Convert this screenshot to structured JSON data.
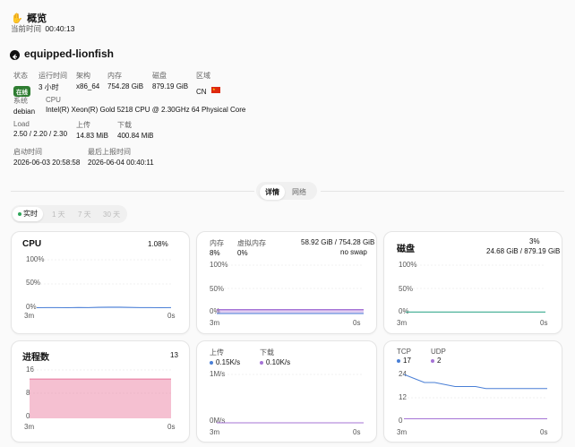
{
  "header": {
    "icon": "waving-hand-icon",
    "title": "概览",
    "time_label": "当前时间",
    "time_value": "00:40:13"
  },
  "server": {
    "name": "equipped-lionfish",
    "back_icon": "back-arrow-icon",
    "fields": {
      "status": {
        "label": "状态",
        "value": "在线"
      },
      "uptime": {
        "label": "运行时间",
        "value": "3 小时"
      },
      "arch": {
        "label": "架构",
        "value": "x86_64"
      },
      "memory": {
        "label": "内存",
        "value": "754.28 GiB"
      },
      "disk": {
        "label": "磁盘",
        "value": "879.19 GiB"
      },
      "region": {
        "label": "区域",
        "value": "CN"
      },
      "system": {
        "label": "系统",
        "value": "debian"
      },
      "cpu": {
        "label": "CPU",
        "value": "Intel(R) Xeon(R) Gold 5218 CPU @ 2.30GHz 64 Physical Core"
      },
      "load": {
        "label": "Load",
        "value": "2.50 / 2.20 / 2.30"
      },
      "upload": {
        "label": "上传",
        "value": "14.83 MiB"
      },
      "download": {
        "label": "下载",
        "value": "400.84 MiB"
      },
      "boot_time": {
        "label": "启动时间",
        "value": "2026-06-03 20:58:58"
      },
      "last_report": {
        "label": "最后上报时间",
        "value": "2026-06-04 00:40:11"
      }
    }
  },
  "tabs": {
    "details": "详情",
    "network": "网络",
    "active": "details"
  },
  "ranges": {
    "realtime": "实时",
    "day1": "1 天",
    "day7": "7 天",
    "day30": "30 天",
    "active": "realtime"
  },
  "cards": {
    "cpu": {
      "title": "CPU",
      "value": "1.08%",
      "y_ticks": [
        "100%",
        "50%",
        "0%"
      ],
      "x_start": "3m",
      "x_end": "0s",
      "chart_data": {
        "type": "area",
        "ylim": [
          0,
          100
        ],
        "values": [
          1.0,
          1.2,
          1.1,
          1.0,
          1.3,
          1.2,
          1.8,
          2.0,
          2.1,
          1.6,
          1.2,
          1.1,
          1.0,
          1.08
        ]
      },
      "color": "#4a7fd6"
    },
    "memory": {
      "mem_label": "内存",
      "mem_value": "8%",
      "swap_label": "虚拟内存",
      "swap_value": "0%",
      "usage": "58.92 GiB / 754.28 GiB",
      "swap_note": "no swap",
      "y_ticks": [
        "100%",
        "50%",
        "0%"
      ],
      "x_start": "3m",
      "x_end": "0s",
      "chart_data": {
        "type": "area",
        "ylim": [
          0,
          100
        ],
        "series": [
          {
            "values": [
              8,
              8,
              8,
              8,
              8,
              8,
              8,
              8
            ]
          },
          {
            "values": [
              0,
              0,
              0,
              0,
              0,
              0,
              0,
              0
            ]
          }
        ]
      },
      "colors": [
        "#a573d6",
        "#4a7fd6"
      ]
    },
    "disk": {
      "title": "磁盘",
      "value": "3%",
      "usage": "24.68 GiB / 879.19 GiB",
      "y_ticks": [
        "100%",
        "50%",
        "0%"
      ],
      "x_start": "3m",
      "x_end": "0s",
      "chart_data": {
        "type": "line",
        "ylim": [
          0,
          100
        ],
        "values": [
          3,
          3,
          3,
          3,
          3,
          3,
          3,
          3
        ]
      },
      "color": "#4fb39a"
    },
    "process": {
      "title": "进程数",
      "value": "13",
      "y_ticks": [
        "16",
        "8",
        "0"
      ],
      "x_start": "3m",
      "x_end": "0s",
      "chart_data": {
        "type": "area",
        "ylim": [
          0,
          16
        ],
        "values": [
          13,
          13,
          13,
          13,
          13,
          13,
          13,
          13
        ]
      },
      "color": "#e8739a"
    },
    "network": {
      "up_label": "上传",
      "up_value": "0.15K/s",
      "down_label": "下载",
      "down_value": "0.10K/s",
      "y_ticks": [
        "1M/s",
        "0M/s"
      ],
      "x_start": "3m",
      "x_end": "0s",
      "chart_data": {
        "type": "line",
        "series": [
          {
            "values": [
              0.15,
              0.15,
              0.15,
              0.15,
              0.15,
              0.15
            ]
          },
          {
            "values": [
              0.1,
              0.1,
              0.1,
              0.1,
              0.1,
              0.1
            ]
          }
        ]
      },
      "colors": [
        "#4a7fd6",
        "#a573d6"
      ]
    },
    "connections": {
      "tcp_label": "TCP",
      "tcp_value": "17",
      "udp_label": "UDP",
      "udp_value": "2",
      "y_ticks": [
        "24",
        "12",
        "0"
      ],
      "x_start": "3m",
      "x_end": "0s",
      "chart_data": {
        "type": "line",
        "ylim": [
          0,
          24
        ],
        "series": [
          {
            "values": [
              24,
              22,
              20,
              20,
              19,
              18,
              18,
              18,
              17,
              17,
              17,
              17,
              17,
              17,
              17
            ]
          },
          {
            "values": [
              2,
              2,
              2,
              2,
              2,
              2,
              2,
              2,
              2,
              2,
              2,
              2,
              2,
              2,
              2
            ]
          }
        ]
      },
      "colors": [
        "#4a7fd6",
        "#a573d6"
      ]
    }
  }
}
